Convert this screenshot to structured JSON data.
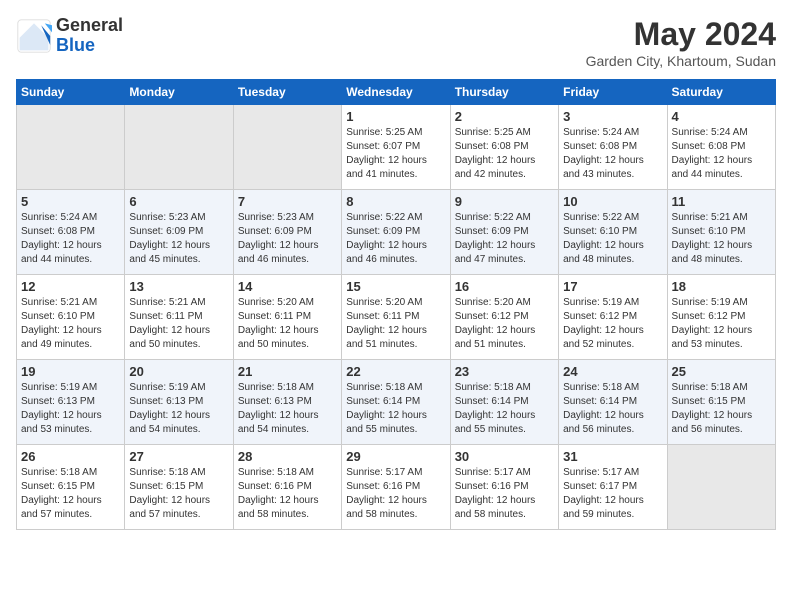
{
  "logo": {
    "general": "General",
    "blue": "Blue"
  },
  "header": {
    "month_year": "May 2024",
    "location": "Garden City, Khartoum, Sudan"
  },
  "weekdays": [
    "Sunday",
    "Monday",
    "Tuesday",
    "Wednesday",
    "Thursday",
    "Friday",
    "Saturday"
  ],
  "weeks": [
    [
      {
        "day": "",
        "empty": true
      },
      {
        "day": "",
        "empty": true
      },
      {
        "day": "",
        "empty": true
      },
      {
        "day": "1",
        "sunrise": "5:25 AM",
        "sunset": "6:07 PM",
        "daylight": "12 hours and 41 minutes."
      },
      {
        "day": "2",
        "sunrise": "5:25 AM",
        "sunset": "6:08 PM",
        "daylight": "12 hours and 42 minutes."
      },
      {
        "day": "3",
        "sunrise": "5:24 AM",
        "sunset": "6:08 PM",
        "daylight": "12 hours and 43 minutes."
      },
      {
        "day": "4",
        "sunrise": "5:24 AM",
        "sunset": "6:08 PM",
        "daylight": "12 hours and 44 minutes."
      }
    ],
    [
      {
        "day": "5",
        "sunrise": "5:24 AM",
        "sunset": "6:08 PM",
        "daylight": "12 hours and 44 minutes."
      },
      {
        "day": "6",
        "sunrise": "5:23 AM",
        "sunset": "6:09 PM",
        "daylight": "12 hours and 45 minutes."
      },
      {
        "day": "7",
        "sunrise": "5:23 AM",
        "sunset": "6:09 PM",
        "daylight": "12 hours and 46 minutes."
      },
      {
        "day": "8",
        "sunrise": "5:22 AM",
        "sunset": "6:09 PM",
        "daylight": "12 hours and 46 minutes."
      },
      {
        "day": "9",
        "sunrise": "5:22 AM",
        "sunset": "6:09 PM",
        "daylight": "12 hours and 47 minutes."
      },
      {
        "day": "10",
        "sunrise": "5:22 AM",
        "sunset": "6:10 PM",
        "daylight": "12 hours and 48 minutes."
      },
      {
        "day": "11",
        "sunrise": "5:21 AM",
        "sunset": "6:10 PM",
        "daylight": "12 hours and 48 minutes."
      }
    ],
    [
      {
        "day": "12",
        "sunrise": "5:21 AM",
        "sunset": "6:10 PM",
        "daylight": "12 hours and 49 minutes."
      },
      {
        "day": "13",
        "sunrise": "5:21 AM",
        "sunset": "6:11 PM",
        "daylight": "12 hours and 50 minutes."
      },
      {
        "day": "14",
        "sunrise": "5:20 AM",
        "sunset": "6:11 PM",
        "daylight": "12 hours and 50 minutes."
      },
      {
        "day": "15",
        "sunrise": "5:20 AM",
        "sunset": "6:11 PM",
        "daylight": "12 hours and 51 minutes."
      },
      {
        "day": "16",
        "sunrise": "5:20 AM",
        "sunset": "6:12 PM",
        "daylight": "12 hours and 51 minutes."
      },
      {
        "day": "17",
        "sunrise": "5:19 AM",
        "sunset": "6:12 PM",
        "daylight": "12 hours and 52 minutes."
      },
      {
        "day": "18",
        "sunrise": "5:19 AM",
        "sunset": "6:12 PM",
        "daylight": "12 hours and 53 minutes."
      }
    ],
    [
      {
        "day": "19",
        "sunrise": "5:19 AM",
        "sunset": "6:13 PM",
        "daylight": "12 hours and 53 minutes."
      },
      {
        "day": "20",
        "sunrise": "5:19 AM",
        "sunset": "6:13 PM",
        "daylight": "12 hours and 54 minutes."
      },
      {
        "day": "21",
        "sunrise": "5:18 AM",
        "sunset": "6:13 PM",
        "daylight": "12 hours and 54 minutes."
      },
      {
        "day": "22",
        "sunrise": "5:18 AM",
        "sunset": "6:14 PM",
        "daylight": "12 hours and 55 minutes."
      },
      {
        "day": "23",
        "sunrise": "5:18 AM",
        "sunset": "6:14 PM",
        "daylight": "12 hours and 55 minutes."
      },
      {
        "day": "24",
        "sunrise": "5:18 AM",
        "sunset": "6:14 PM",
        "daylight": "12 hours and 56 minutes."
      },
      {
        "day": "25",
        "sunrise": "5:18 AM",
        "sunset": "6:15 PM",
        "daylight": "12 hours and 56 minutes."
      }
    ],
    [
      {
        "day": "26",
        "sunrise": "5:18 AM",
        "sunset": "6:15 PM",
        "daylight": "12 hours and 57 minutes."
      },
      {
        "day": "27",
        "sunrise": "5:18 AM",
        "sunset": "6:15 PM",
        "daylight": "12 hours and 57 minutes."
      },
      {
        "day": "28",
        "sunrise": "5:18 AM",
        "sunset": "6:16 PM",
        "daylight": "12 hours and 58 minutes."
      },
      {
        "day": "29",
        "sunrise": "5:17 AM",
        "sunset": "6:16 PM",
        "daylight": "12 hours and 58 minutes."
      },
      {
        "day": "30",
        "sunrise": "5:17 AM",
        "sunset": "6:16 PM",
        "daylight": "12 hours and 58 minutes."
      },
      {
        "day": "31",
        "sunrise": "5:17 AM",
        "sunset": "6:17 PM",
        "daylight": "12 hours and 59 minutes."
      },
      {
        "day": "",
        "empty": true
      }
    ]
  ]
}
